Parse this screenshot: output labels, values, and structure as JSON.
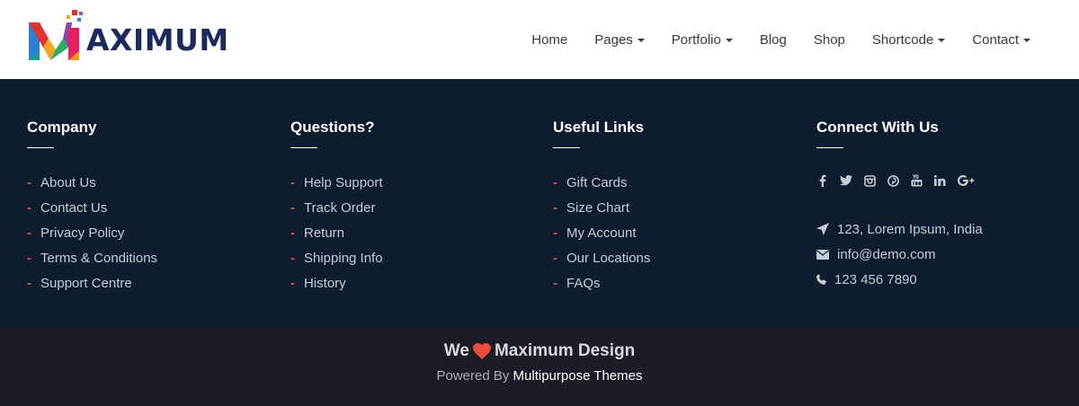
{
  "header": {
    "logo_text": "AXIMUM",
    "nav": [
      {
        "label": "Home",
        "dropdown": false
      },
      {
        "label": "Pages",
        "dropdown": true
      },
      {
        "label": "Portfolio",
        "dropdown": true
      },
      {
        "label": "Blog",
        "dropdown": false
      },
      {
        "label": "Shop",
        "dropdown": false
      },
      {
        "label": "Shortcode",
        "dropdown": true
      },
      {
        "label": "Contact",
        "dropdown": true
      }
    ]
  },
  "footer": {
    "company": {
      "title": "Company",
      "links": [
        "About Us",
        "Contact Us",
        "Privacy Policy",
        "Terms & Conditions",
        "Support Centre"
      ]
    },
    "questions": {
      "title": "Questions?",
      "links": [
        "Help Support",
        "Track Order",
        "Return",
        "Shipping Info",
        "History"
      ]
    },
    "useful": {
      "title": "Useful Links",
      "links": [
        "Gift Cards",
        "Size Chart",
        "My Account",
        "Our Locations",
        "FAQs"
      ]
    },
    "connect": {
      "title": "Connect With Us",
      "social_icons": [
        "facebook-icon",
        "twitter-icon",
        "instagram-icon",
        "pinterest-icon",
        "youtube-icon",
        "linkedin-icon",
        "google-plus-icon"
      ],
      "address": "123, Lorem Ipsum, India",
      "email": "info@demo.com",
      "phone": "123 456 7890"
    }
  },
  "bottom": {
    "tagline_prefix": "We",
    "tagline_suffix": "Maximum Design",
    "powered_prefix": "Powered By",
    "powered_link": "Multipurpose Themes"
  },
  "colors": {
    "footer_bg": "#0e1c2f",
    "bottom_bg": "#1b1c25",
    "accent_red": "#e74c3c",
    "logo_navy": "#1b2a5e"
  }
}
